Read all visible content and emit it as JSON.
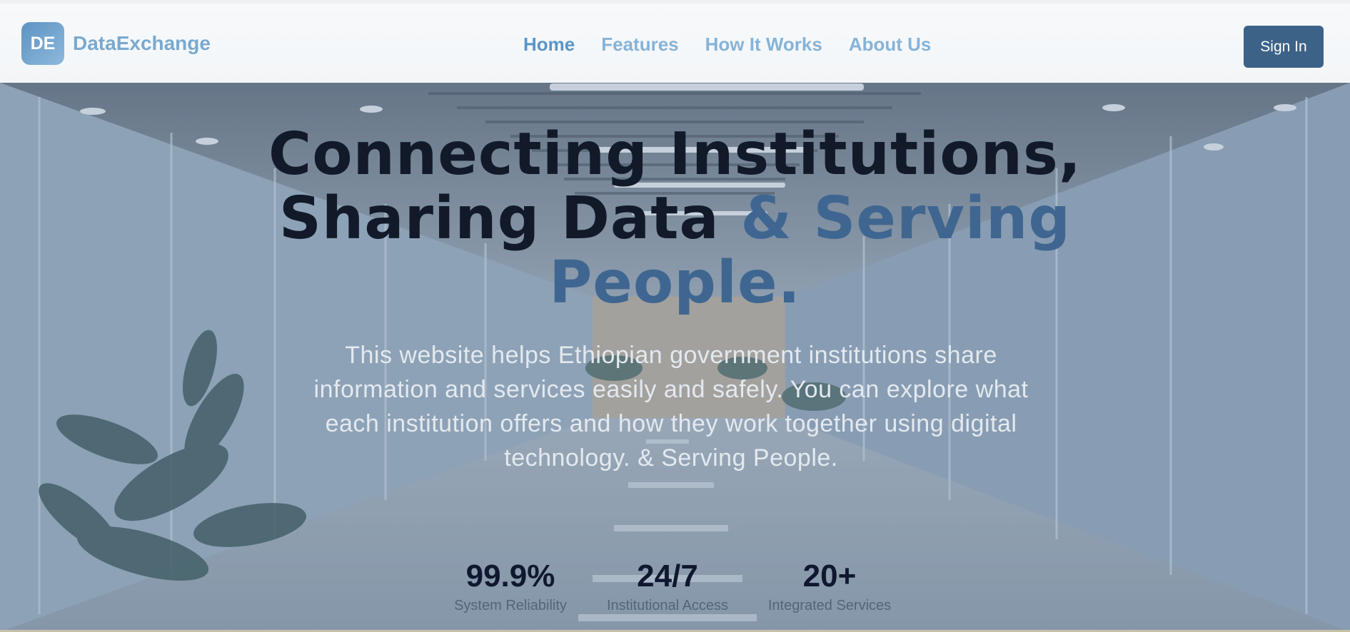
{
  "brand": {
    "initials": "DE",
    "name": "DataExchange"
  },
  "nav": {
    "items": [
      {
        "label": "Home"
      },
      {
        "label": "Features"
      },
      {
        "label": "How It Works"
      },
      {
        "label": "About Us"
      }
    ],
    "active": "Home"
  },
  "header": {
    "signin_label": "Sign In"
  },
  "hero": {
    "title_line1": "Connecting Institutions,",
    "title_line2_dark": "Sharing Data",
    "title_line2_accent": "& Serving",
    "title_line3_accent": "People.",
    "description": "This website helps Ethiopian government institutions share information and services easily and safely. You can explore what each institution offers and how they work together using digital technology. & Serving People.",
    "background_image": "office-corridor"
  },
  "stats": [
    {
      "value": "99.9%",
      "label": "System Reliability"
    },
    {
      "value": "24/7",
      "label": "Institutional Access"
    },
    {
      "value": "20+",
      "label": "Integrated Services"
    }
  ],
  "colors": {
    "brand_accent": "#3f6690",
    "nav_link": "#86b3d8",
    "signin_bg": "#3d6288",
    "title_dark": "#121a2a"
  }
}
